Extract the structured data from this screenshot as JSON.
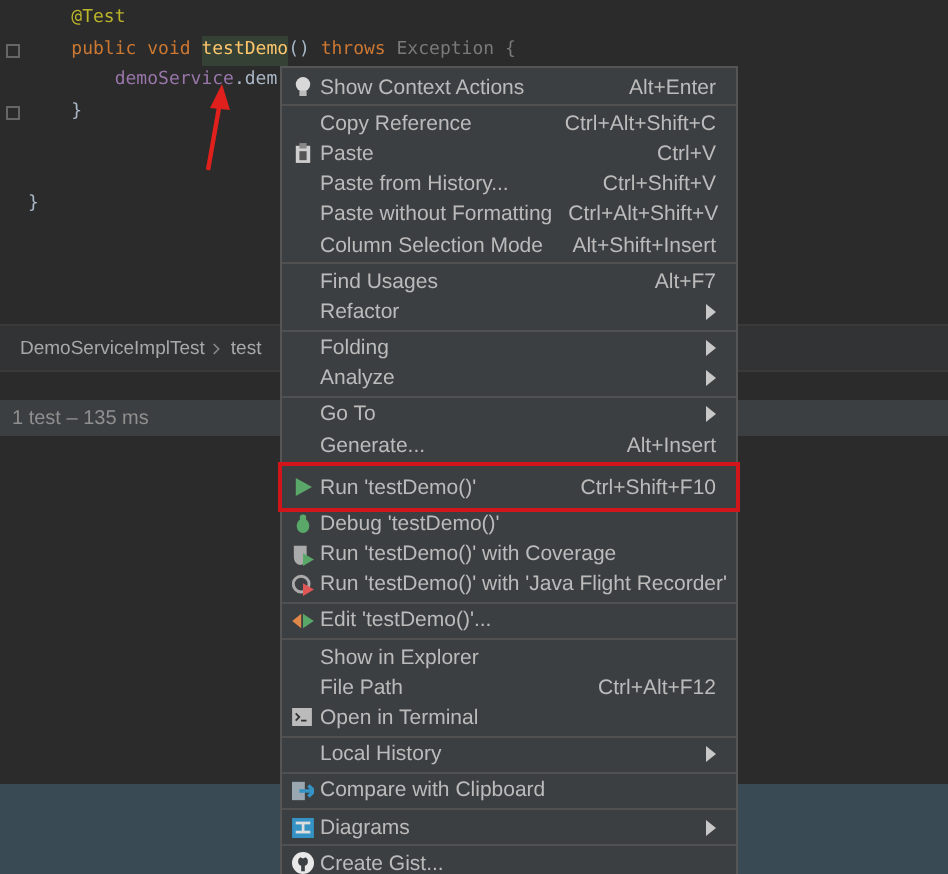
{
  "editor": {
    "lines": [
      {
        "fold": false,
        "tokens": [
          {
            "text": "    @Test",
            "kind": "annotation"
          }
        ]
      },
      {
        "fold": true,
        "tokens": [
          {
            "text": "    public void ",
            "kind": "keyword"
          },
          {
            "text": "testDemo",
            "kind": "method"
          },
          {
            "text": "() ",
            "kind": "plain"
          },
          {
            "text": "throws ",
            "kind": "keyword"
          },
          {
            "text": "Exception {",
            "kind": "muted"
          }
        ]
      },
      {
        "fold": false,
        "tokens": [
          {
            "text": "        demoService",
            "kind": "field"
          },
          {
            "text": ".dem",
            "kind": "plain"
          }
        ]
      },
      {
        "fold": true,
        "tokens": [
          {
            "text": "    }",
            "kind": "plain"
          }
        ]
      },
      {
        "fold": false
      },
      {
        "fold": false
      },
      {
        "fold": false,
        "tokens": [
          {
            "text": "}",
            "kind": "plain"
          }
        ]
      }
    ]
  },
  "breadcrumb": [
    "DemoServiceImplTest",
    "test"
  ],
  "test_status": "1 test – 135 ms",
  "menu": [
    [
      {
        "label": "Show Context Actions",
        "shortcut": "Alt+Enter",
        "kind": "bulb",
        "submenu": false,
        "highlighted": false
      }
    ],
    [
      {
        "label": "Copy Reference",
        "shortcut": "Ctrl+Alt+Shift+C",
        "submenu": false,
        "highlighted": false
      },
      {
        "label": "Paste",
        "shortcut": "Ctrl+V",
        "kind": "clipboard",
        "submenu": false,
        "highlighted": false
      },
      {
        "label": "Paste from History...",
        "shortcut": "Ctrl+Shift+V",
        "submenu": false,
        "highlighted": false
      },
      {
        "label": "Paste without Formatting",
        "shortcut": "Ctrl+Alt+Shift+V",
        "submenu": false,
        "highlighted": false
      },
      {
        "label": "Column Selection Mode",
        "shortcut": "Alt+Shift+Insert",
        "submenu": false,
        "highlighted": false
      }
    ],
    [
      {
        "label": "Find Usages",
        "shortcut": "Alt+F7",
        "submenu": false,
        "highlighted": false
      },
      {
        "label": "Refactor",
        "submenu": true,
        "highlighted": false
      }
    ],
    [
      {
        "label": "Folding",
        "submenu": true,
        "highlighted": false
      },
      {
        "label": "Analyze",
        "submenu": true,
        "highlighted": false
      }
    ],
    [
      {
        "label": "Go To",
        "submenu": true,
        "highlighted": false
      },
      {
        "label": "Generate...",
        "shortcut": "Alt+Insert",
        "submenu": false,
        "highlighted": false
      }
    ],
    [
      {
        "label": "Run 'testDemo()'",
        "shortcut": "Ctrl+Shift+F10",
        "kind": "play",
        "submenu": false,
        "highlighted": true
      },
      {
        "label": "Debug 'testDemo()'",
        "kind": "bug",
        "submenu": false,
        "highlighted": false
      },
      {
        "label": "Run 'testDemo()' with Coverage",
        "kind": "coverage",
        "submenu": false,
        "highlighted": false
      },
      {
        "label": "Run 'testDemo()' with 'Java Flight Recorder'",
        "kind": "recorder",
        "submenu": false,
        "highlighted": false
      }
    ],
    [
      {
        "label": "Edit 'testDemo()'...",
        "kind": "edit",
        "submenu": false,
        "highlighted": false
      }
    ],
    [
      {
        "label": "Show in Explorer",
        "submenu": false,
        "highlighted": false
      },
      {
        "label": "File Path",
        "shortcut": "Ctrl+Alt+F12",
        "submenu": false,
        "highlighted": false
      },
      {
        "label": "Open in Terminal",
        "kind": "terminal",
        "submenu": false,
        "highlighted": false
      }
    ],
    [
      {
        "label": "Local History",
        "submenu": true,
        "highlighted": false
      }
    ],
    [
      {
        "label": "Compare with Clipboard",
        "kind": "compare",
        "submenu": false,
        "highlighted": false
      }
    ],
    [
      {
        "label": "Diagrams",
        "kind": "diagram",
        "submenu": true,
        "highlighted": false
      }
    ],
    [
      {
        "label": "Create Gist...",
        "kind": "github",
        "submenu": false,
        "highlighted": false
      }
    ]
  ]
}
